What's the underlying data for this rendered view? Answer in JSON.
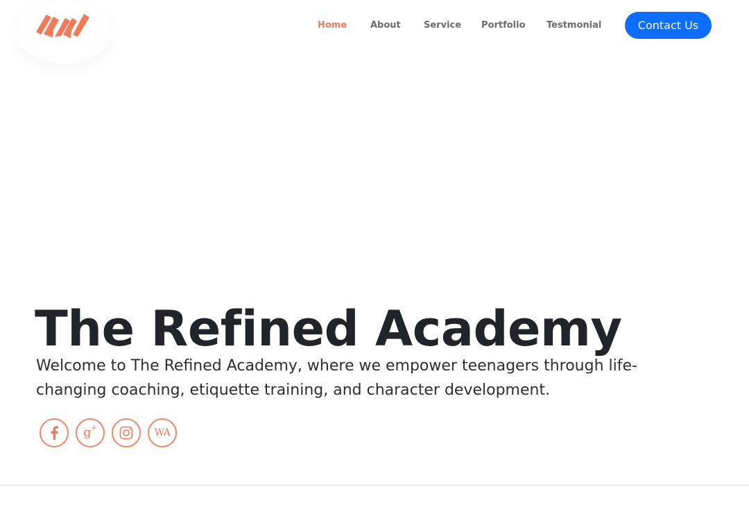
{
  "header": {
    "nav": [
      {
        "label": "Home",
        "active": true
      },
      {
        "label": "About",
        "active": false
      },
      {
        "label": "Service",
        "active": false
      },
      {
        "label": "Portfolio",
        "active": false
      },
      {
        "label": "Testmonial",
        "active": false
      }
    ],
    "contact_button": "Contact Us",
    "logo_icon": "stripes-logo-icon"
  },
  "hero": {
    "title": "The Refined Academy",
    "subtitle": "Welcome to The Refined Academy, where we empower teenagers through life-changing coaching, etiquette training, and character development."
  },
  "socials": {
    "facebook": {
      "icon": "facebook-icon"
    },
    "google_plus": {
      "icon": "google-plus-icon",
      "glyph": "g",
      "sup": "+"
    },
    "instagram": {
      "icon": "instagram-icon"
    },
    "whatsapp": {
      "icon": "whatsapp-icon",
      "glyph": "WA"
    }
  },
  "colors": {
    "accent": "#f07b5a",
    "button": "#0d6efd",
    "text": "#212529",
    "nav_text": "#6c6c6c"
  }
}
